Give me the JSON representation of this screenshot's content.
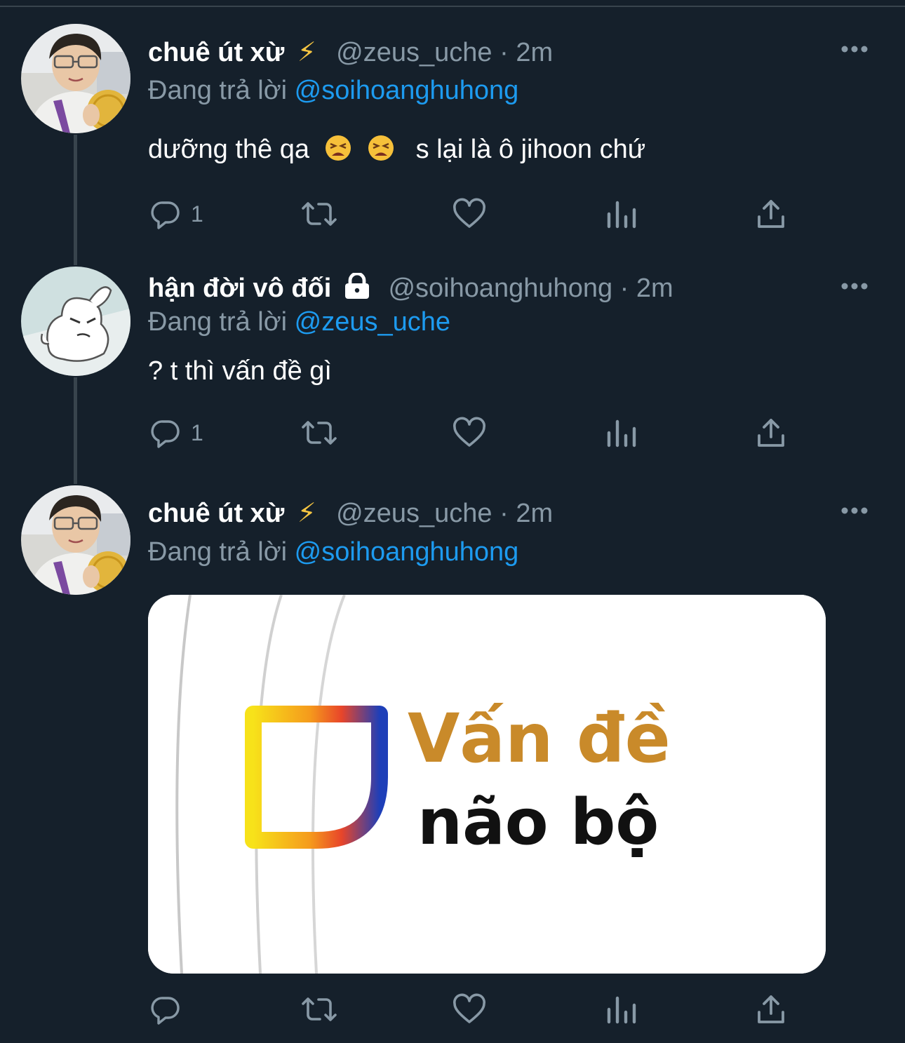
{
  "tweets": [
    {
      "display_name": "chuê út xừ",
      "name_badge": "⚡",
      "handle": "@zeus_uche",
      "separator": "·",
      "time": "2m",
      "replying_label": "Đang trả lời",
      "replying_to": "@soihoanghuhong",
      "text_before_emoji": "dưỡng thê qa",
      "text_after_emoji": "s lại là ô jihoon chứ",
      "emoji_icons": [
        "tired-face-icon",
        "tired-face-icon"
      ],
      "reply_count": "1",
      "avatar": "profile-photo-medal"
    },
    {
      "display_name": "hận đời vô đối",
      "name_badge": "lock-icon",
      "handle": "@soihoanghuhong",
      "separator": "·",
      "time": "2m",
      "replying_label": "Đang trả lời",
      "replying_to": "@zeus_uche",
      "text": "? t thì vấn đề gì",
      "reply_count": "1",
      "avatar": "cartoon-dog"
    },
    {
      "display_name": "chuê út xừ",
      "name_badge": "⚡",
      "handle": "@zeus_uche",
      "separator": "·",
      "time": "2m",
      "replying_label": "Đang trả lời",
      "replying_to": "@soihoanghuhong",
      "reply_count": "",
      "avatar": "profile-photo-medal",
      "media": {
        "line1": "Vấn đề",
        "line2": "não bộ"
      }
    }
  ],
  "icons": [
    "reply-icon",
    "retweet-icon",
    "like-icon",
    "analytics-icon",
    "share-icon",
    "more-icon"
  ],
  "colors": {
    "background": "#15202b",
    "text": "#ffffff",
    "secondary": "#8899a6",
    "link": "#1d9bf0",
    "thread_line": "#38444d"
  }
}
